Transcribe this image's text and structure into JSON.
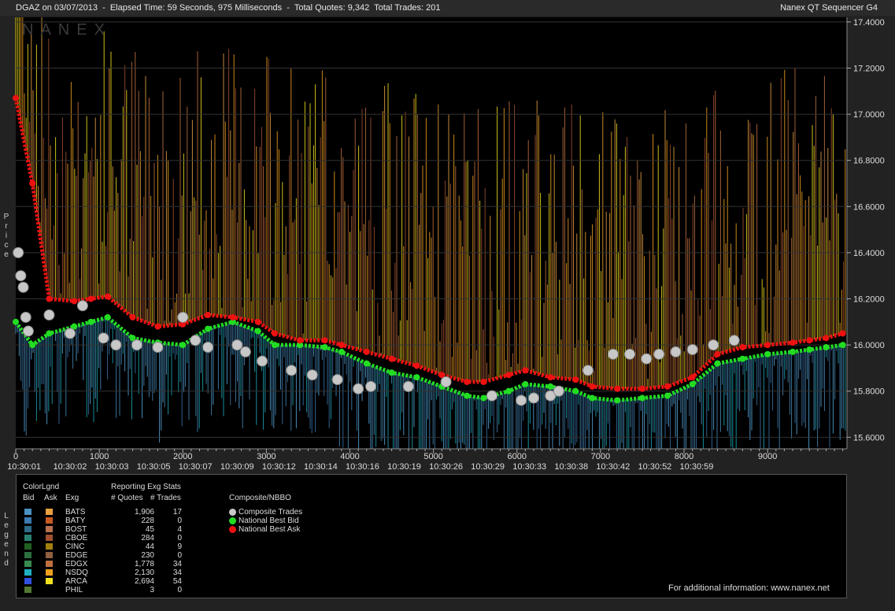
{
  "header": {
    "title": "DGAZ on 03/07/2013  -  Elapsed Time: 59 Seconds, 975 Milliseconds  -  Total Quotes: 9,342  Total Trades: 201",
    "program": "Nanex QT Sequencer G4"
  },
  "watermark": "NANEX",
  "side_labels": {
    "price": "Price",
    "legend": "Legend"
  },
  "legend": {
    "color_legend_title": "ColorLgnd",
    "bid_header": "Bid",
    "ask_header": "Ask",
    "exg_header": "Exg",
    "stats_title": "Reporting Exg Stats",
    "quotes_header": "# Quotes",
    "trades_header": "# Trades",
    "composite_title": "Composite/NBBO",
    "composite_items": [
      {
        "label": "Composite Trades",
        "color": "#c8c8c8"
      },
      {
        "label": "National Best Bid",
        "color": "#22dd22"
      },
      {
        "label": "National Best Ask",
        "color": "#ee1111"
      }
    ],
    "exchanges": [
      {
        "exg": "BATS",
        "quotes": "1,906",
        "trades": "17",
        "bid_color": "#4a90c0",
        "ask_color": "#e8a040"
      },
      {
        "exg": "BATY",
        "quotes": "228",
        "trades": "0",
        "bid_color": "#3d7ab0",
        "ask_color": "#c85a20"
      },
      {
        "exg": "BOST",
        "quotes": "45",
        "trades": "4",
        "bid_color": "#2e6b8a",
        "ask_color": "#b87050"
      },
      {
        "exg": "CBOE",
        "quotes": "284",
        "trades": "0",
        "bid_color": "#2a8070",
        "ask_color": "#a05030"
      },
      {
        "exg": "CINC",
        "quotes": "44",
        "trades": "9",
        "bid_color": "#206020",
        "ask_color": "#a08010"
      },
      {
        "exg": "EDGE",
        "quotes": "230",
        "trades": "0",
        "bid_color": "#2a7040",
        "ask_color": "#906040"
      },
      {
        "exg": "EDGX",
        "quotes": "1,778",
        "trades": "34",
        "bid_color": "#3a8a50",
        "ask_color": "#c07040"
      },
      {
        "exg": "NSDQ",
        "quotes": "2,130",
        "trades": "34",
        "bid_color": "#20b0c0",
        "ask_color": "#f0a020"
      },
      {
        "exg": "ARCA",
        "quotes": "2,694",
        "trades": "54",
        "bid_color": "#3050e0",
        "ask_color": "#f0e020"
      },
      {
        "exg": "PHIL",
        "quotes": "3",
        "trades": "0",
        "bid_color": "#507830",
        "ask_color": ""
      }
    ],
    "footer": "For additional information: www.nanex.net"
  },
  "chart_data": {
    "type": "line",
    "x_axis": {
      "range": [
        0,
        9950
      ],
      "ticks": [
        0,
        1000,
        2000,
        3000,
        4000,
        5000,
        6000,
        7000,
        8000,
        9000
      ],
      "time_labels": [
        {
          "seq": 100,
          "label": "10:30:01"
        },
        {
          "seq": 650,
          "label": "10:30:02"
        },
        {
          "seq": 1150,
          "label": "10:30:03"
        },
        {
          "seq": 1650,
          "label": "10:30:05"
        },
        {
          "seq": 2150,
          "label": "10:30:07"
        },
        {
          "seq": 2650,
          "label": "10:30:09"
        },
        {
          "seq": 3150,
          "label": "10:30:12"
        },
        {
          "seq": 3650,
          "label": "10:30:14"
        },
        {
          "seq": 4150,
          "label": "10:30:16"
        },
        {
          "seq": 4650,
          "label": "10:30:19"
        },
        {
          "seq": 5150,
          "label": "10:30:26"
        },
        {
          "seq": 5650,
          "label": "10:30:29"
        },
        {
          "seq": 6150,
          "label": "10:30:33"
        },
        {
          "seq": 6650,
          "label": "10:30:38"
        },
        {
          "seq": 7150,
          "label": "10:30:42"
        },
        {
          "seq": 7650,
          "label": "10:30:52"
        },
        {
          "seq": 8150,
          "label": "10:30:59"
        }
      ]
    },
    "y_axis": {
      "range": [
        15.55,
        17.42
      ],
      "ticks": [
        "15.6000",
        "15.8000",
        "16.0000",
        "16.2000",
        "16.4000",
        "16.6000",
        "16.8000",
        "17.0000",
        "17.2000",
        "17.4000"
      ],
      "side": "right",
      "grid": true
    },
    "series": [
      {
        "name": "National Best Bid",
        "color": "#22dd22",
        "points": [
          [
            0,
            16.1
          ],
          [
            200,
            16.0
          ],
          [
            400,
            16.05
          ],
          [
            700,
            16.08
          ],
          [
            900,
            16.1
          ],
          [
            1100,
            16.12
          ],
          [
            1400,
            16.03
          ],
          [
            1700,
            16.01
          ],
          [
            2000,
            16.0
          ],
          [
            2300,
            16.07
          ],
          [
            2600,
            16.1
          ],
          [
            2900,
            16.06
          ],
          [
            3100,
            16.0
          ],
          [
            3400,
            16.0
          ],
          [
            3700,
            15.99
          ],
          [
            3900,
            15.97
          ],
          [
            4200,
            15.92
          ],
          [
            4500,
            15.88
          ],
          [
            4800,
            15.86
          ],
          [
            5100,
            15.82
          ],
          [
            5400,
            15.78
          ],
          [
            5600,
            15.77
          ],
          [
            5900,
            15.8
          ],
          [
            6100,
            15.83
          ],
          [
            6400,
            15.82
          ],
          [
            6700,
            15.8
          ],
          [
            6900,
            15.77
          ],
          [
            7200,
            15.76
          ],
          [
            7500,
            15.77
          ],
          [
            7800,
            15.78
          ],
          [
            8100,
            15.83
          ],
          [
            8400,
            15.92
          ],
          [
            8700,
            15.94
          ],
          [
            9000,
            15.96
          ],
          [
            9300,
            15.97
          ],
          [
            9500,
            15.98
          ],
          [
            9700,
            15.99
          ],
          [
            9900,
            16.0
          ]
        ]
      },
      {
        "name": "National Best Ask",
        "color": "#ee1111",
        "points": [
          [
            0,
            17.07
          ],
          [
            200,
            16.7
          ],
          [
            400,
            16.2
          ],
          [
            700,
            16.19
          ],
          [
            900,
            16.2
          ],
          [
            1100,
            16.21
          ],
          [
            1400,
            16.12
          ],
          [
            1700,
            16.08
          ],
          [
            2000,
            16.09
          ],
          [
            2300,
            16.13
          ],
          [
            2600,
            16.12
          ],
          [
            2900,
            16.1
          ],
          [
            3100,
            16.05
          ],
          [
            3400,
            16.02
          ],
          [
            3700,
            16.02
          ],
          [
            3900,
            16.0
          ],
          [
            4200,
            15.97
          ],
          [
            4500,
            15.94
          ],
          [
            4800,
            15.91
          ],
          [
            5100,
            15.87
          ],
          [
            5400,
            15.84
          ],
          [
            5600,
            15.84
          ],
          [
            5900,
            15.87
          ],
          [
            6100,
            15.89
          ],
          [
            6400,
            15.86
          ],
          [
            6700,
            15.85
          ],
          [
            6900,
            15.82
          ],
          [
            7200,
            15.81
          ],
          [
            7500,
            15.81
          ],
          [
            7800,
            15.82
          ],
          [
            8100,
            15.86
          ],
          [
            8400,
            15.96
          ],
          [
            8700,
            15.99
          ],
          [
            9000,
            16.0
          ],
          [
            9300,
            16.01
          ],
          [
            9500,
            16.02
          ],
          [
            9700,
            16.03
          ],
          [
            9900,
            16.05
          ]
        ]
      },
      {
        "name": "Composite Trades",
        "color": "#c8c8c8",
        "points": [
          [
            30,
            16.4
          ],
          [
            60,
            16.3
          ],
          [
            90,
            16.25
          ],
          [
            120,
            16.12
          ],
          [
            150,
            16.06
          ],
          [
            400,
            16.13
          ],
          [
            650,
            16.05
          ],
          [
            800,
            16.17
          ],
          [
            1050,
            16.03
          ],
          [
            1200,
            16.0
          ],
          [
            1450,
            16.0
          ],
          [
            1700,
            15.99
          ],
          [
            2000,
            16.12
          ],
          [
            2150,
            16.02
          ],
          [
            2300,
            15.99
          ],
          [
            2650,
            16.0
          ],
          [
            2750,
            15.97
          ],
          [
            2950,
            15.93
          ],
          [
            3300,
            15.89
          ],
          [
            3550,
            15.87
          ],
          [
            3850,
            15.85
          ],
          [
            4100,
            15.81
          ],
          [
            4250,
            15.82
          ],
          [
            4700,
            15.82
          ],
          [
            5150,
            15.84
          ],
          [
            5700,
            15.78
          ],
          [
            6050,
            15.76
          ],
          [
            6200,
            15.77
          ],
          [
            6400,
            15.78
          ],
          [
            6500,
            15.8
          ],
          [
            6850,
            15.89
          ],
          [
            7150,
            15.96
          ],
          [
            7350,
            15.96
          ],
          [
            7550,
            15.94
          ],
          [
            7700,
            15.96
          ],
          [
            7900,
            15.97
          ],
          [
            8100,
            15.98
          ],
          [
            8350,
            16.0
          ],
          [
            8600,
            16.02
          ]
        ]
      }
    ]
  }
}
